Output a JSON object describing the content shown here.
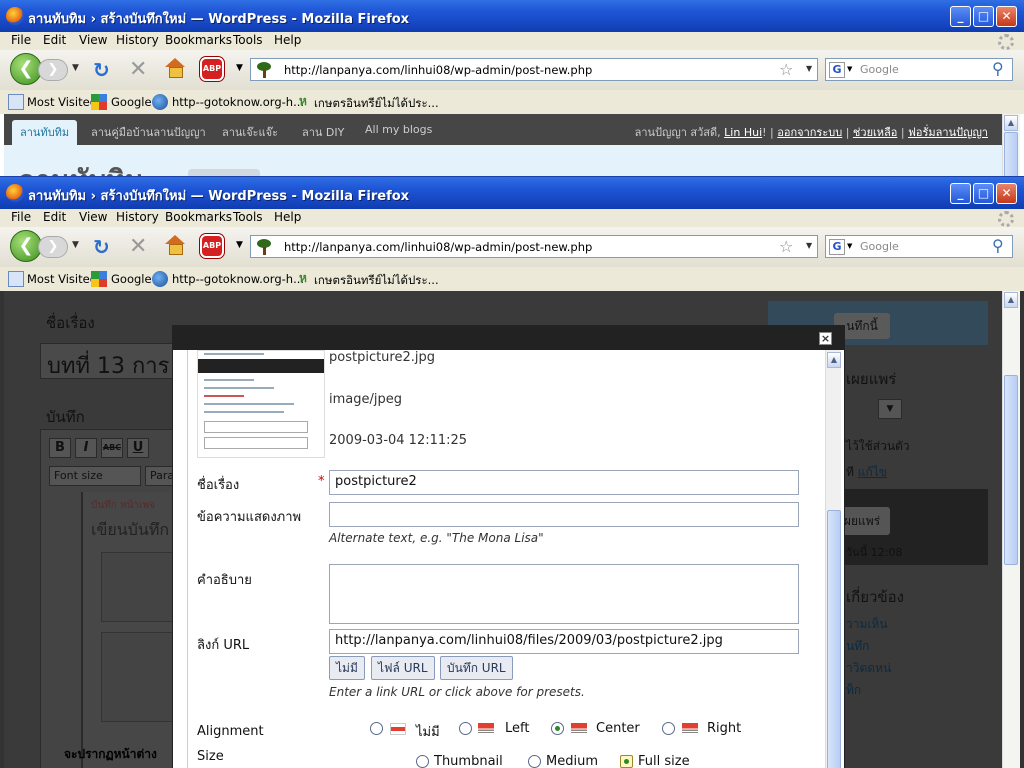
{
  "browser": {
    "title": "ลานทับทิม › สร้างบันทึกใหม่ — WordPress - Mozilla Firefox",
    "menu": [
      "File",
      "Edit",
      "View",
      "History",
      "Bookmarks",
      "Tools",
      "Help"
    ],
    "url": "http://lanpanya.com/linhui08/wp-admin/post-new.php",
    "search_placeholder": "Google",
    "abp_label": "ABP",
    "bookmarks": [
      "Most Visited",
      "Google",
      "http--gotoknow.org-h...",
      "เกษตรอินทรีย์ไม่ได้ประ..."
    ]
  },
  "wp_admin_bar": {
    "active_tab": "ลานทับทิม",
    "links": [
      "ลานคู่มือบ้านลานปัญญา",
      "ลานเจ๊ะแจ๊ะ",
      "ลาน DIY",
      "All my blogs"
    ],
    "greeting": "ลานปัญญา สวัสดี,",
    "user": "Lin Hui",
    "exclaim": "!",
    "sep": "|",
    "logout": "ออกจากระบบ",
    "help": "ช่วยเหลือ",
    "forum": "ฟอรั่มลานปัญญา",
    "blog_title": "ลานทับทิม"
  },
  "background_editor": {
    "title_label": "ชื่อเรื่อง",
    "title_value": "บทที่ 13 การ",
    "post_label": "บันทึก",
    "toolbar": [
      "B",
      "I",
      "ABC",
      "U"
    ],
    "font_size": "Font size",
    "paragraph": "Para",
    "inner_tabs": "บันทึก     หน้าเพจ",
    "inner_heading": "เขียนบันทึก",
    "footer": "จะปรากฏหน้าต่าง"
  },
  "background_sidebar": {
    "publish_btn": "นทึกนี้",
    "publish_heading": "เผยแพร่",
    "private_text": "ไว้ใช้ส่วนตัว",
    "edit_prefix": "ที",
    "edit_link": "แก้ไข",
    "publish_btn2": "ผยแพร่",
    "time_text": "วันนี้ 12:08",
    "related_heading": "เกี่ยวข้อง",
    "links": [
      "วามเห็น",
      "นทึก",
      "าวิตดหน่",
      "ท็ก"
    ]
  },
  "media": {
    "filename": "postpicture2.jpg",
    "mime": "image/jpeg",
    "date": "2009-03-04 12:11:25",
    "title_label": "ชื่อเรื่อง",
    "required_mark": "*",
    "title_value": "postpicture2",
    "alt_label": "ข้อความแสดงภาพ",
    "alt_value": "",
    "alt_help": "Alternate text, e.g. \"The Mona Lisa\"",
    "desc_label": "คำอธิบาย",
    "desc_value": "",
    "link_label": "ลิงก์ URL",
    "link_value": "http://lanpanya.com/linhui08/files/2009/03/postpicture2.jpg",
    "link_buttons": [
      "ไม่มี",
      "ไฟล์ URL",
      "บันทึก URL"
    ],
    "link_help": "Enter a link URL or click above for presets.",
    "alignment_label": "Alignment",
    "alignment_options": [
      "ไม่มี",
      "Left",
      "Center",
      "Right"
    ],
    "alignment_selected": "Center",
    "size_label": "Size",
    "size_options": [
      "Thumbnail",
      "Medium",
      "Full size"
    ],
    "size_selected": "Full size"
  }
}
